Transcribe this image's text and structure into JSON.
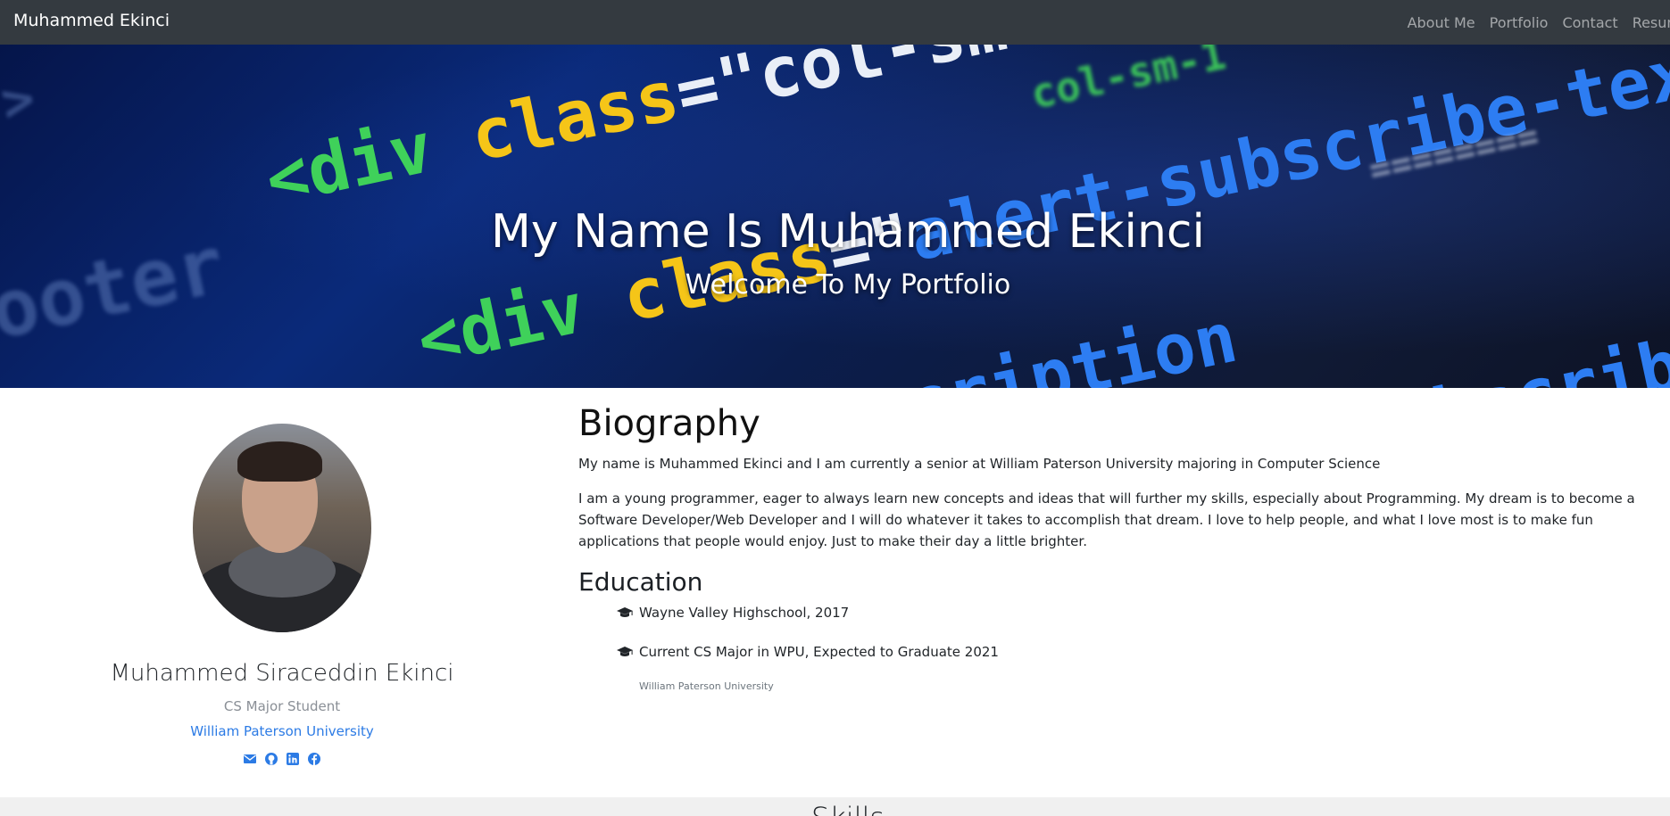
{
  "navbar": {
    "brand": "Muhammed Ekinci",
    "links": [
      "About Me",
      "Portfolio",
      "Contact",
      "Resum"
    ]
  },
  "hero": {
    "title": "My Name Is Muhammed Ekinci",
    "subtitle": "Welcome To My Portfolio"
  },
  "profile": {
    "name": "Muhammed Siraceddin Ekinci",
    "role": "CS Major Student",
    "school": "William Paterson University",
    "socials": [
      "envelope-icon",
      "github-icon",
      "linkedin-icon",
      "facebook-icon"
    ]
  },
  "biography": {
    "title": "Biography",
    "paragraphs": [
      "My name is Muhammed Ekinci and I am currently a senior at William Paterson University majoring in Computer Science",
      "I am a young programmer, eager to always learn new concepts and ideas that will further my skills, especially about Programming. My dream is to become a Software Developer/Web Developer and I will do whatever it takes to accomplish that dream. I love to help people, and what I love most is to make fun applications that people would enjoy. Just to make their day a little brighter."
    ]
  },
  "education": {
    "title": "Education",
    "items": [
      "Wayne Valley Highschool, 2017",
      "Current CS Major in WPU, Expected to Graduate 2021"
    ],
    "caption": "William Paterson University"
  },
  "skills": {
    "title": "Skills"
  },
  "colors": {
    "navbar": "#343a40",
    "link_accent": "#2c7be5",
    "skills_band": "#f0f0f0"
  }
}
